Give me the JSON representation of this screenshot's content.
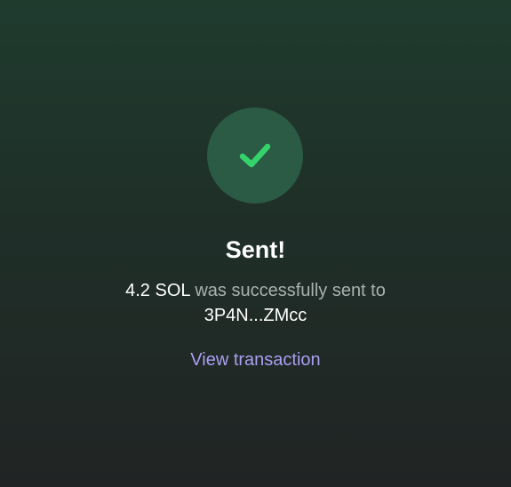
{
  "success": {
    "icon": "checkmark-icon",
    "icon_color": "#35d36b",
    "circle_color": "#2b5a45"
  },
  "title": "Sent!",
  "message": {
    "amount": "4.2 SOL",
    "text": " was successfully sent to",
    "recipient": "3P4N...ZMcc"
  },
  "view_link_label": "View transaction",
  "colors": {
    "link": "#ab9ff2",
    "muted_text": "#a9b1ad"
  }
}
